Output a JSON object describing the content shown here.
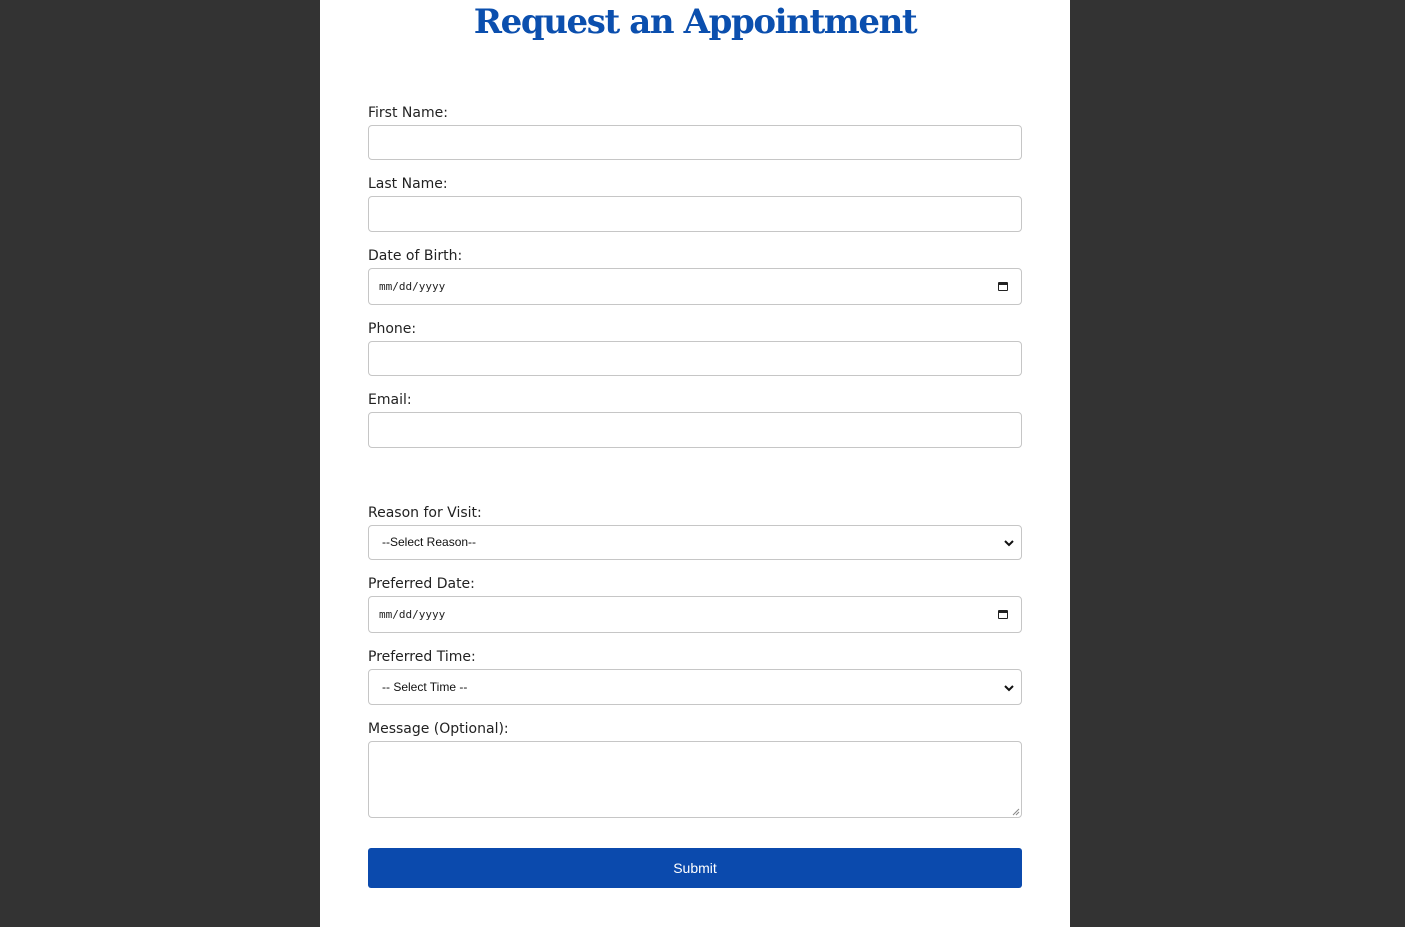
{
  "page": {
    "title": "Request an Appointment",
    "colors": {
      "background": "#333333",
      "panel": "#ffffff",
      "accent": "#0b4aad",
      "title": "#0b4fae"
    }
  },
  "form": {
    "first_name": {
      "label": "First Name:",
      "value": ""
    },
    "last_name": {
      "label": "Last Name:",
      "value": ""
    },
    "dob": {
      "label": "Date of Birth:",
      "value": "mm/dd/yyyy",
      "icon": "calendar-icon"
    },
    "phone": {
      "label": "Phone:",
      "value": ""
    },
    "email": {
      "label": "Email:",
      "value": ""
    },
    "reason": {
      "label": "Reason for Visit:",
      "selected": "--Select Reason--",
      "icon": "chevron-down-icon"
    },
    "preferred_date": {
      "label": "Preferred Date:",
      "value": "mm/dd/yyyy",
      "icon": "calendar-icon"
    },
    "preferred_time": {
      "label": "Preferred Time:",
      "selected": "-- Select Time --",
      "icon": "chevron-down-icon"
    },
    "message": {
      "label": "Message (Optional):",
      "value": ""
    },
    "submit_label": "Submit"
  }
}
